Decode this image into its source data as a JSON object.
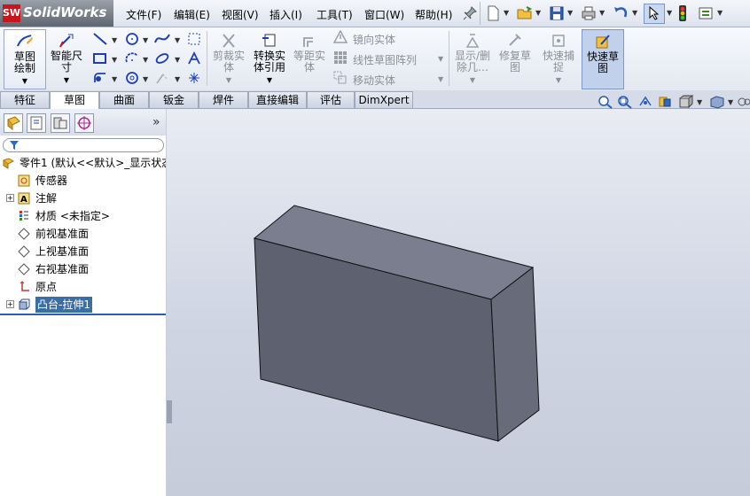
{
  "app": {
    "name": "SolidWorks",
    "logo_mark": "SW"
  },
  "menu": [
    "文件(F)",
    "编辑(E)",
    "视图(V)",
    "插入(I)",
    "工具(T)",
    "窗口(W)",
    "帮助(H)"
  ],
  "command_manager": {
    "sketch": "草图绘制",
    "smart_dimension": "智能尺寸",
    "trim": "剪裁实体",
    "convert": "转换实体引用",
    "offset": "等距实体",
    "mirror": "镜向实体",
    "linear_pattern": "线性草图阵列",
    "move": "移动实体",
    "display_delete": "显示/删除几…",
    "repair": "修复草图",
    "quick_snap": "快速捕捉",
    "rapid_sketch": "快速草图"
  },
  "tabs": [
    "特征",
    "草图",
    "曲面",
    "钣金",
    "焊件",
    "直接编辑",
    "评估",
    "DimXpert"
  ],
  "active_tab": "草图",
  "tree": {
    "root": "零件1 (默认<<默认>_显示状态",
    "items": [
      "传感器",
      "注解",
      "材质 <未指定>",
      "前视基准面",
      "上视基准面",
      "右视基准面",
      "原点",
      "凸台-拉伸1"
    ],
    "selected": "凸台-拉伸1"
  },
  "colors": {
    "accent": "#c8161d",
    "selected_bg": "#3a6ea5",
    "part_front": "#5e6170",
    "part_top": "#7b7e8f",
    "part_side": "#686b7a"
  }
}
